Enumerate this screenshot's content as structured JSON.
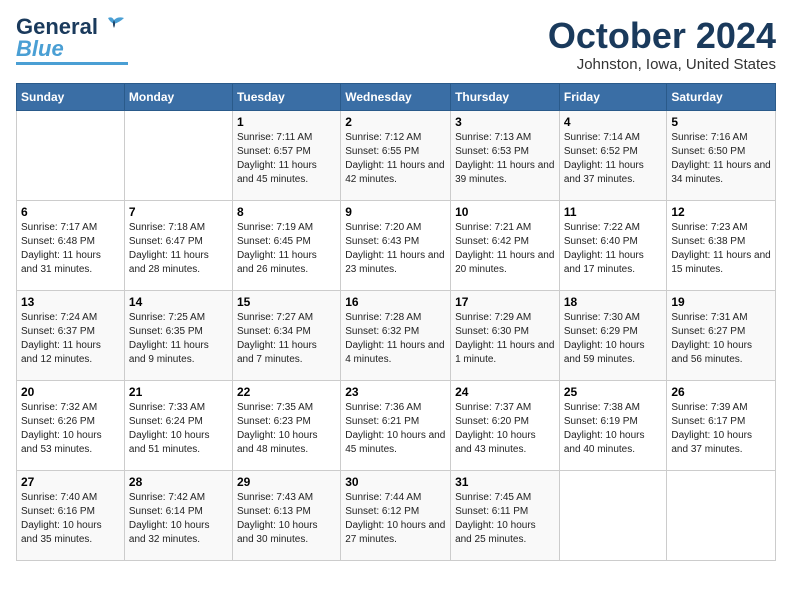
{
  "header": {
    "logo_general": "General",
    "logo_blue": "Blue",
    "title": "October 2024",
    "subtitle": "Johnston, Iowa, United States"
  },
  "weekdays": [
    "Sunday",
    "Monday",
    "Tuesday",
    "Wednesday",
    "Thursday",
    "Friday",
    "Saturday"
  ],
  "weeks": [
    [
      {
        "day": "",
        "info": ""
      },
      {
        "day": "",
        "info": ""
      },
      {
        "day": "1",
        "info": "Sunrise: 7:11 AM\nSunset: 6:57 PM\nDaylight: 11 hours and 45 minutes."
      },
      {
        "day": "2",
        "info": "Sunrise: 7:12 AM\nSunset: 6:55 PM\nDaylight: 11 hours and 42 minutes."
      },
      {
        "day": "3",
        "info": "Sunrise: 7:13 AM\nSunset: 6:53 PM\nDaylight: 11 hours and 39 minutes."
      },
      {
        "day": "4",
        "info": "Sunrise: 7:14 AM\nSunset: 6:52 PM\nDaylight: 11 hours and 37 minutes."
      },
      {
        "day": "5",
        "info": "Sunrise: 7:16 AM\nSunset: 6:50 PM\nDaylight: 11 hours and 34 minutes."
      }
    ],
    [
      {
        "day": "6",
        "info": "Sunrise: 7:17 AM\nSunset: 6:48 PM\nDaylight: 11 hours and 31 minutes."
      },
      {
        "day": "7",
        "info": "Sunrise: 7:18 AM\nSunset: 6:47 PM\nDaylight: 11 hours and 28 minutes."
      },
      {
        "day": "8",
        "info": "Sunrise: 7:19 AM\nSunset: 6:45 PM\nDaylight: 11 hours and 26 minutes."
      },
      {
        "day": "9",
        "info": "Sunrise: 7:20 AM\nSunset: 6:43 PM\nDaylight: 11 hours and 23 minutes."
      },
      {
        "day": "10",
        "info": "Sunrise: 7:21 AM\nSunset: 6:42 PM\nDaylight: 11 hours and 20 minutes."
      },
      {
        "day": "11",
        "info": "Sunrise: 7:22 AM\nSunset: 6:40 PM\nDaylight: 11 hours and 17 minutes."
      },
      {
        "day": "12",
        "info": "Sunrise: 7:23 AM\nSunset: 6:38 PM\nDaylight: 11 hours and 15 minutes."
      }
    ],
    [
      {
        "day": "13",
        "info": "Sunrise: 7:24 AM\nSunset: 6:37 PM\nDaylight: 11 hours and 12 minutes."
      },
      {
        "day": "14",
        "info": "Sunrise: 7:25 AM\nSunset: 6:35 PM\nDaylight: 11 hours and 9 minutes."
      },
      {
        "day": "15",
        "info": "Sunrise: 7:27 AM\nSunset: 6:34 PM\nDaylight: 11 hours and 7 minutes."
      },
      {
        "day": "16",
        "info": "Sunrise: 7:28 AM\nSunset: 6:32 PM\nDaylight: 11 hours and 4 minutes."
      },
      {
        "day": "17",
        "info": "Sunrise: 7:29 AM\nSunset: 6:30 PM\nDaylight: 11 hours and 1 minute."
      },
      {
        "day": "18",
        "info": "Sunrise: 7:30 AM\nSunset: 6:29 PM\nDaylight: 10 hours and 59 minutes."
      },
      {
        "day": "19",
        "info": "Sunrise: 7:31 AM\nSunset: 6:27 PM\nDaylight: 10 hours and 56 minutes."
      }
    ],
    [
      {
        "day": "20",
        "info": "Sunrise: 7:32 AM\nSunset: 6:26 PM\nDaylight: 10 hours and 53 minutes."
      },
      {
        "day": "21",
        "info": "Sunrise: 7:33 AM\nSunset: 6:24 PM\nDaylight: 10 hours and 51 minutes."
      },
      {
        "day": "22",
        "info": "Sunrise: 7:35 AM\nSunset: 6:23 PM\nDaylight: 10 hours and 48 minutes."
      },
      {
        "day": "23",
        "info": "Sunrise: 7:36 AM\nSunset: 6:21 PM\nDaylight: 10 hours and 45 minutes."
      },
      {
        "day": "24",
        "info": "Sunrise: 7:37 AM\nSunset: 6:20 PM\nDaylight: 10 hours and 43 minutes."
      },
      {
        "day": "25",
        "info": "Sunrise: 7:38 AM\nSunset: 6:19 PM\nDaylight: 10 hours and 40 minutes."
      },
      {
        "day": "26",
        "info": "Sunrise: 7:39 AM\nSunset: 6:17 PM\nDaylight: 10 hours and 37 minutes."
      }
    ],
    [
      {
        "day": "27",
        "info": "Sunrise: 7:40 AM\nSunset: 6:16 PM\nDaylight: 10 hours and 35 minutes."
      },
      {
        "day": "28",
        "info": "Sunrise: 7:42 AM\nSunset: 6:14 PM\nDaylight: 10 hours and 32 minutes."
      },
      {
        "day": "29",
        "info": "Sunrise: 7:43 AM\nSunset: 6:13 PM\nDaylight: 10 hours and 30 minutes."
      },
      {
        "day": "30",
        "info": "Sunrise: 7:44 AM\nSunset: 6:12 PM\nDaylight: 10 hours and 27 minutes."
      },
      {
        "day": "31",
        "info": "Sunrise: 7:45 AM\nSunset: 6:11 PM\nDaylight: 10 hours and 25 minutes."
      },
      {
        "day": "",
        "info": ""
      },
      {
        "day": "",
        "info": ""
      }
    ]
  ]
}
